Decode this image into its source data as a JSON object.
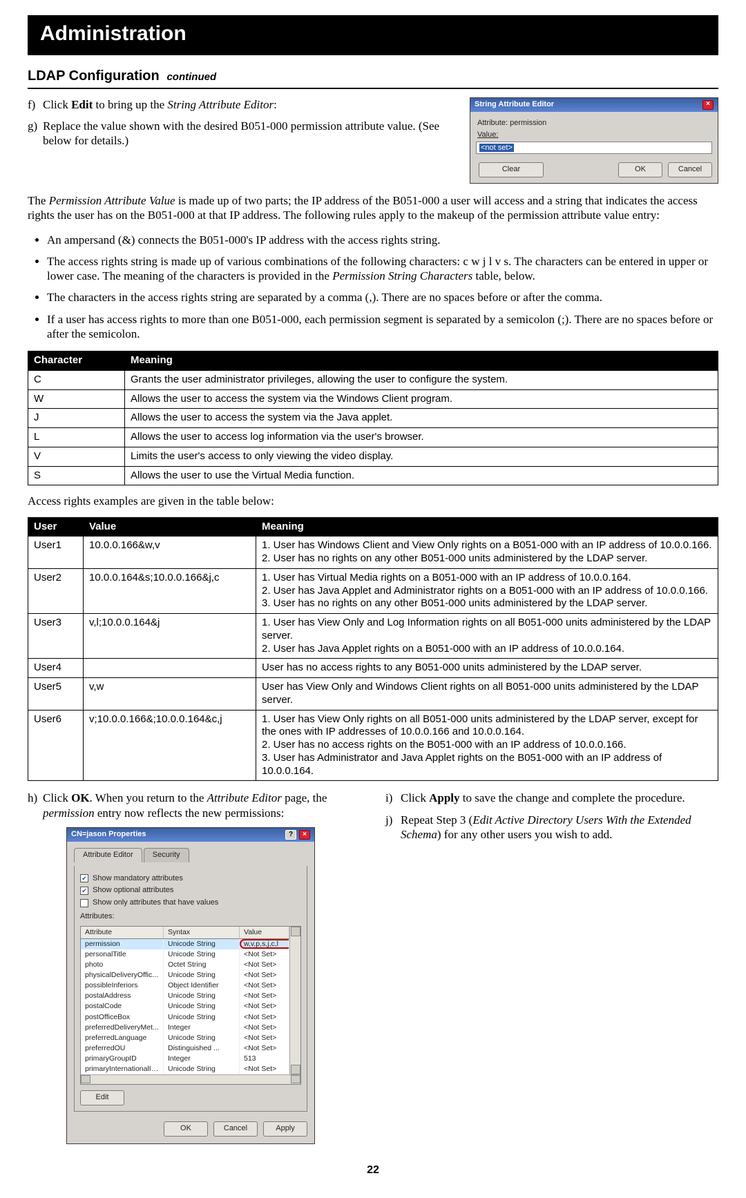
{
  "header": {
    "title": "Administration"
  },
  "section": {
    "title": "LDAP Configuration",
    "cont": "continued"
  },
  "steps_top": {
    "f_marker": "f)",
    "f_pre": "Click ",
    "f_bold": "Edit",
    "f_mid": " to bring up the ",
    "f_em": "String Attribute Editor",
    "f_post": ":",
    "g_marker": "g)",
    "g_text": "Replace the value shown with the desired B051-000 permission attribute value. (See below for details.)"
  },
  "string_editor": {
    "title": "String Attribute Editor",
    "attr_label": "Attribute: permission",
    "value_label": "Value:",
    "value_text": "<not set>",
    "btn_clear": "Clear",
    "btn_ok": "OK",
    "btn_cancel": "Cancel"
  },
  "para_pav_pre": "The ",
  "para_pav_em": "Permission Attribute Value",
  "para_pav_post": " is made up of two parts; the IP address of the B051-000 a user will access and a string that indicates the access rights the user has on the B051-000 at that IP address. The following rules apply to the makeup of the permission attribute value entry:",
  "bullets": {
    "a": "An ampersand (&) connects the B051-000's IP address with the access rights string.",
    "b_pre": "The access rights string is made up of various combinations of the following characters: c w j l v s. The characters can be entered in upper or lower case. The meaning of the characters is provided in the ",
    "b_em": "Permission String Characters",
    "b_post": " table, below.",
    "c": "The characters in the access rights string are separated by a comma (,). There are no spaces before or after the comma.",
    "d": "If a user has access rights to more than one B051-000, each permission segment is separated by a semicolon (;). There are no spaces before or after the semicolon."
  },
  "char_table": {
    "headers": [
      "Character",
      "Meaning"
    ],
    "rows": [
      [
        "C",
        "Grants the user administrator privileges, allowing the user to configure the system."
      ],
      [
        "W",
        "Allows the user to access the system via the Windows Client program."
      ],
      [
        "J",
        "Allows the user to access the system via the Java applet."
      ],
      [
        "L",
        "Allows the user to access log information via the user's browser."
      ],
      [
        "V",
        "Limits the user's access to only viewing the video display."
      ],
      [
        "S",
        "Allows the user to use the Virtual Media function."
      ]
    ]
  },
  "between_tables": "Access rights examples are given in the table below:",
  "ex_table": {
    "headers": [
      "User",
      "Value",
      "Meaning"
    ],
    "rows": [
      {
        "user": "User1",
        "value": "10.0.0.166&w,v",
        "meaning": "1. User has Windows Client and View Only rights on a B051-000 with an IP address of 10.0.0.166.\n2. User has no rights on any other B051-000 units administered by the LDAP server."
      },
      {
        "user": "User2",
        "value": "10.0.0.164&s;10.0.0.166&j,c",
        "meaning": "1. User has Virtual Media rights on a B051-000 with an IP address of 10.0.0.164.\n2. User has Java Applet and Administrator rights on a B051-000 with an IP address of 10.0.0.166.\n3. User has no rights on any other B051-000 units administered by the LDAP server."
      },
      {
        "user": "User3",
        "value": "v,l;10.0.0.164&j",
        "meaning": "1. User has View Only and Log Information rights on all B051-000 units administered by the LDAP server.\n2. User has Java Applet rights on a B051-000 with an IP address of 10.0.0.164."
      },
      {
        "user": "User4",
        "value": "",
        "meaning": "User has no access rights to any B051-000 units administered by the LDAP server."
      },
      {
        "user": "User5",
        "value": "v,w",
        "meaning": "User has View Only and Windows Client rights on all B051-000 units administered by the LDAP server."
      },
      {
        "user": "User6",
        "value": "v;10.0.0.166&;10.0.0.164&c,j",
        "meaning": "1. User has View Only rights on all B051-000 units administered by the LDAP server, except for the ones with IP addresses of 10.0.0.166 and 10.0.0.164.\n2. User has no access rights on the B051-000 with an IP address of 10.0.0.166.\n3. User has Administrator and Java Applet rights on the B051-000 with an IP address of 10.0.0.164."
      }
    ]
  },
  "steps_bottom": {
    "h_marker": "h)",
    "h_pre": "Click ",
    "h_bold": "OK",
    "h_mid": ". When you return to the ",
    "h_em1": "Attribute Editor",
    "h_mid2": " page, the ",
    "h_em2": "permission",
    "h_post": " entry now reflects the new permissions:",
    "i_marker": "i)",
    "i_pre": "Click ",
    "i_bold": "Apply",
    "i_post": " to save the change and complete the procedure.",
    "j_marker": "j)",
    "j_pre": "Repeat Step 3 (",
    "j_em": "Edit Active Directory Users With the Extended Schema",
    "j_post": ") for any other users you wish to add."
  },
  "ae": {
    "title": "CN=jason Properties",
    "tab1": "Attribute Editor",
    "tab2": "Security",
    "chk1": "Show mandatory attributes",
    "chk2": "Show optional attributes",
    "chk3": "Show only attributes that have values",
    "list_label": "Attributes:",
    "cols": [
      "Attribute",
      "Syntax",
      "Value"
    ],
    "rows": [
      {
        "a": "permission",
        "s": "Unicode String",
        "v": "w,v,p,s,j,c,l"
      },
      {
        "a": "personalTitle",
        "s": "Unicode String",
        "v": "<Not Set>"
      },
      {
        "a": "photo",
        "s": "Octet String",
        "v": "<Not Set>"
      },
      {
        "a": "physicalDeliveryOffic...",
        "s": "Unicode String",
        "v": "<Not Set>"
      },
      {
        "a": "possibleInferiors",
        "s": "Object Identifier",
        "v": "<Not Set>"
      },
      {
        "a": "postalAddress",
        "s": "Unicode String",
        "v": "<Not Set>"
      },
      {
        "a": "postalCode",
        "s": "Unicode String",
        "v": "<Not Set>"
      },
      {
        "a": "postOfficeBox",
        "s": "Unicode String",
        "v": "<Not Set>"
      },
      {
        "a": "preferredDeliveryMet...",
        "s": "Integer",
        "v": "<Not Set>"
      },
      {
        "a": "preferredLanguage",
        "s": "Unicode String",
        "v": "<Not Set>"
      },
      {
        "a": "preferredOU",
        "s": "Distinguished ...",
        "v": "<Not Set>"
      },
      {
        "a": "primaryGroupID",
        "s": "Integer",
        "v": "513"
      },
      {
        "a": "primaryInternationalIS...",
        "s": "Unicode String",
        "v": "<Not Set>"
      }
    ],
    "btn_edit": "Edit",
    "btn_ok": "OK",
    "btn_cancel": "Cancel",
    "btn_apply": "Apply"
  },
  "page_number": "22"
}
